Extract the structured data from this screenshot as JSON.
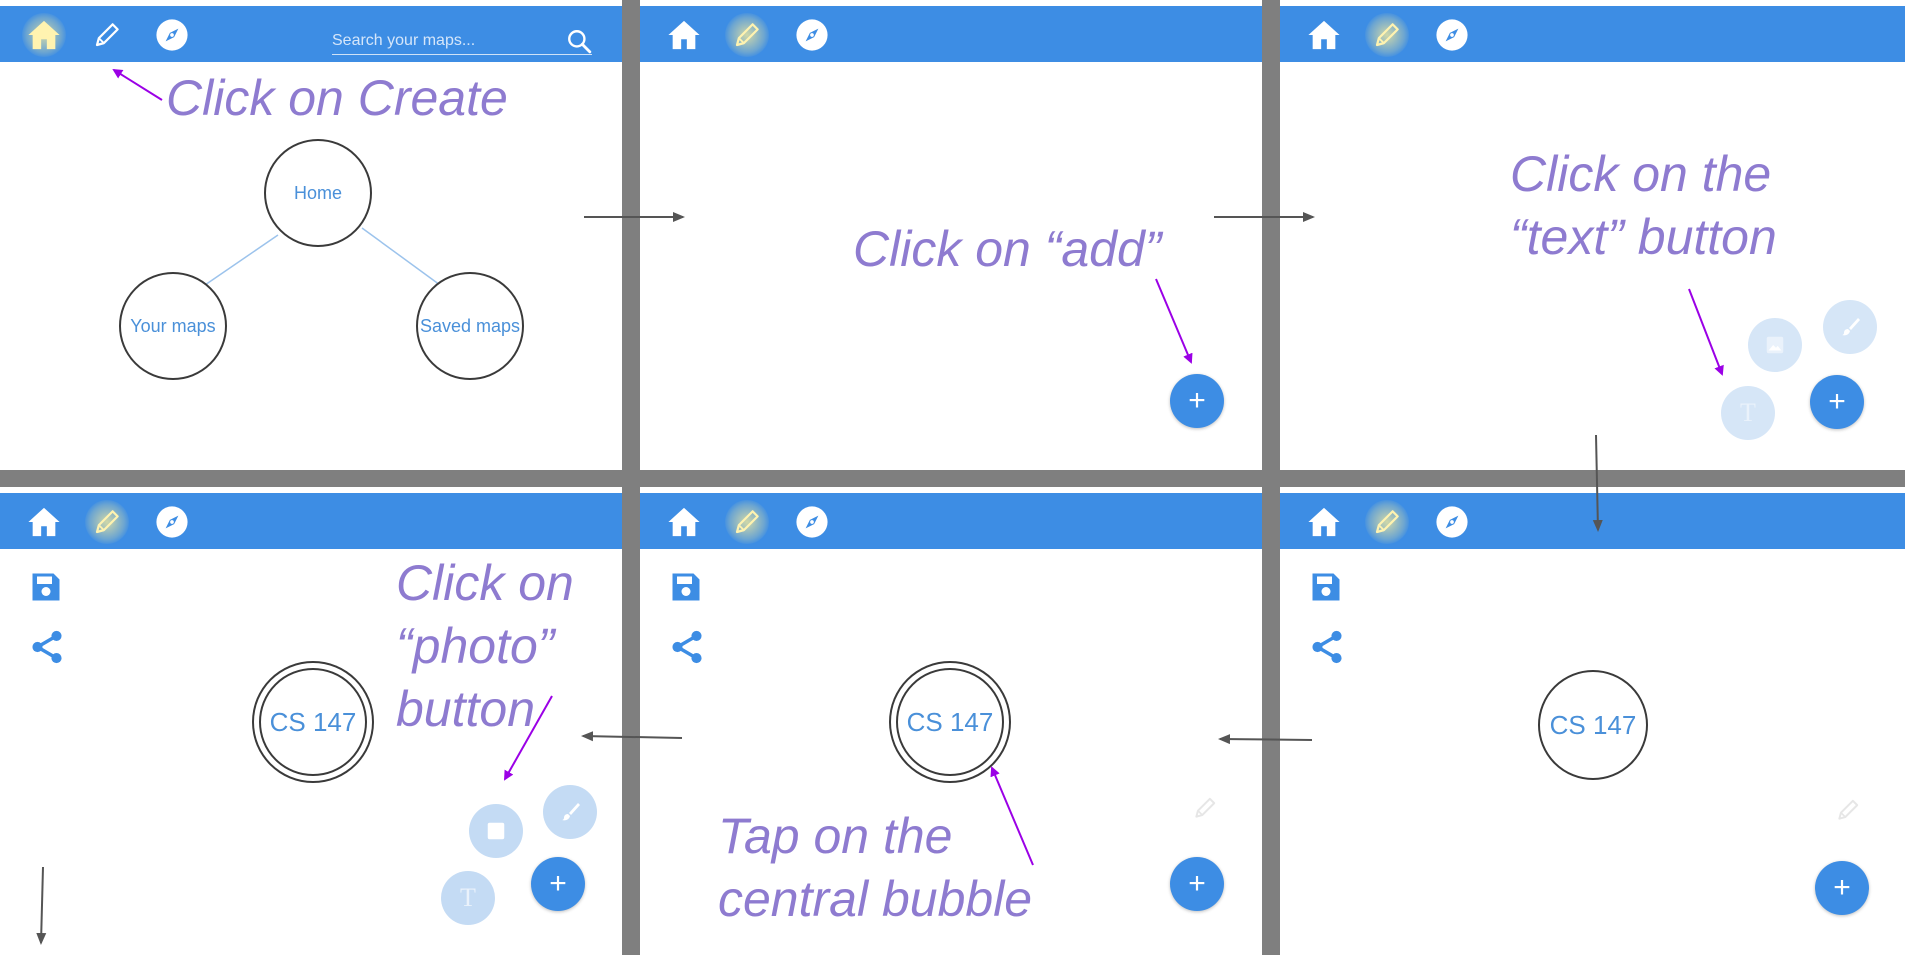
{
  "search": {
    "placeholder": "Search your maps..."
  },
  "nav": {
    "home": "home-icon",
    "create": "pencil-icon",
    "explore": "compass-icon"
  },
  "panel1": {
    "instruction": "Click on Create",
    "bubbles": {
      "home": "Home",
      "your_maps": "Your maps",
      "saved_maps": "Saved maps"
    }
  },
  "panel2": {
    "instruction": "Click on “add”",
    "add": "+"
  },
  "panel3": {
    "instruction_line1": "Click on the",
    "instruction_line2": "“text” button",
    "add": "+",
    "text_button": "T"
  },
  "panel4": {
    "instruction_line1": "Click on",
    "instruction_line2": "“photo”",
    "instruction_line3": "button",
    "bubble": "CS 147",
    "add": "+",
    "text_button": "T"
  },
  "panel5": {
    "instruction_line1": "Tap on the",
    "instruction_line2": "central bubble",
    "bubble": "CS 147",
    "add": "+"
  },
  "panel6": {
    "bubble": "CS 147",
    "add": "+"
  },
  "colors": {
    "accent": "#3d8de4",
    "instruction": "#8e7bd0",
    "pointer": "#9b00e6",
    "flow_arrow": "#555555"
  }
}
